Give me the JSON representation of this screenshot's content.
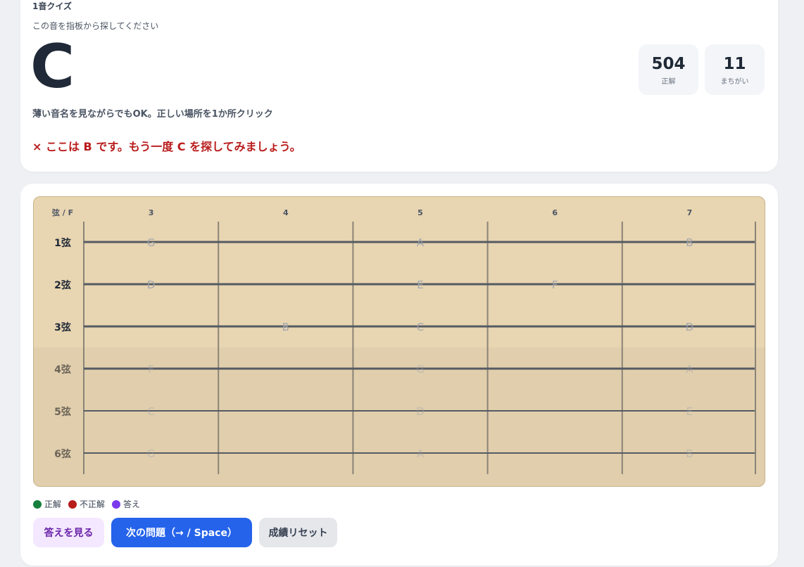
{
  "quiz": {
    "mode_label": "1音クイズ",
    "prompt": "この音を指板から探してください",
    "target_note": "C",
    "hint": "薄い音名を見ながらでもOK。正しい場所を1か所クリック",
    "feedback": "× ここは B です。もう一度 C を探してみましょう。"
  },
  "stats": {
    "correct_value": "504",
    "correct_label": "正解",
    "wrong_value": "11",
    "wrong_label": "まちがい"
  },
  "fretboard": {
    "corner_label": "弦 / F",
    "frets": [
      "3",
      "4",
      "5",
      "6",
      "7"
    ],
    "strings": [
      "1弦",
      "2弦",
      "3弦",
      "4弦",
      "5弦",
      "6弦"
    ],
    "notes": [
      [
        "G",
        "",
        "A",
        "",
        "B"
      ],
      [
        "D",
        "",
        "E",
        "F",
        ""
      ],
      [
        "",
        "B",
        "C",
        "",
        "D"
      ],
      [
        "F",
        "",
        "G",
        "",
        "A"
      ],
      [
        "C",
        "",
        "D",
        "",
        "E"
      ],
      [
        "G",
        "",
        "A",
        "",
        "B"
      ]
    ],
    "colors": {
      "wood": "#e8d5b1",
      "string": "#555b63",
      "fret": "#8a8478",
      "note": "#9ca3af"
    }
  },
  "legend": [
    {
      "label": "正解",
      "color": "#15803d"
    },
    {
      "label": "不正解",
      "color": "#b91c1c"
    },
    {
      "label": "答え",
      "color": "#7c3aed"
    }
  ],
  "buttons": {
    "show_answer": "答えを見る",
    "next": "次の問題（→ / Space）",
    "reset": "成績リセット"
  }
}
